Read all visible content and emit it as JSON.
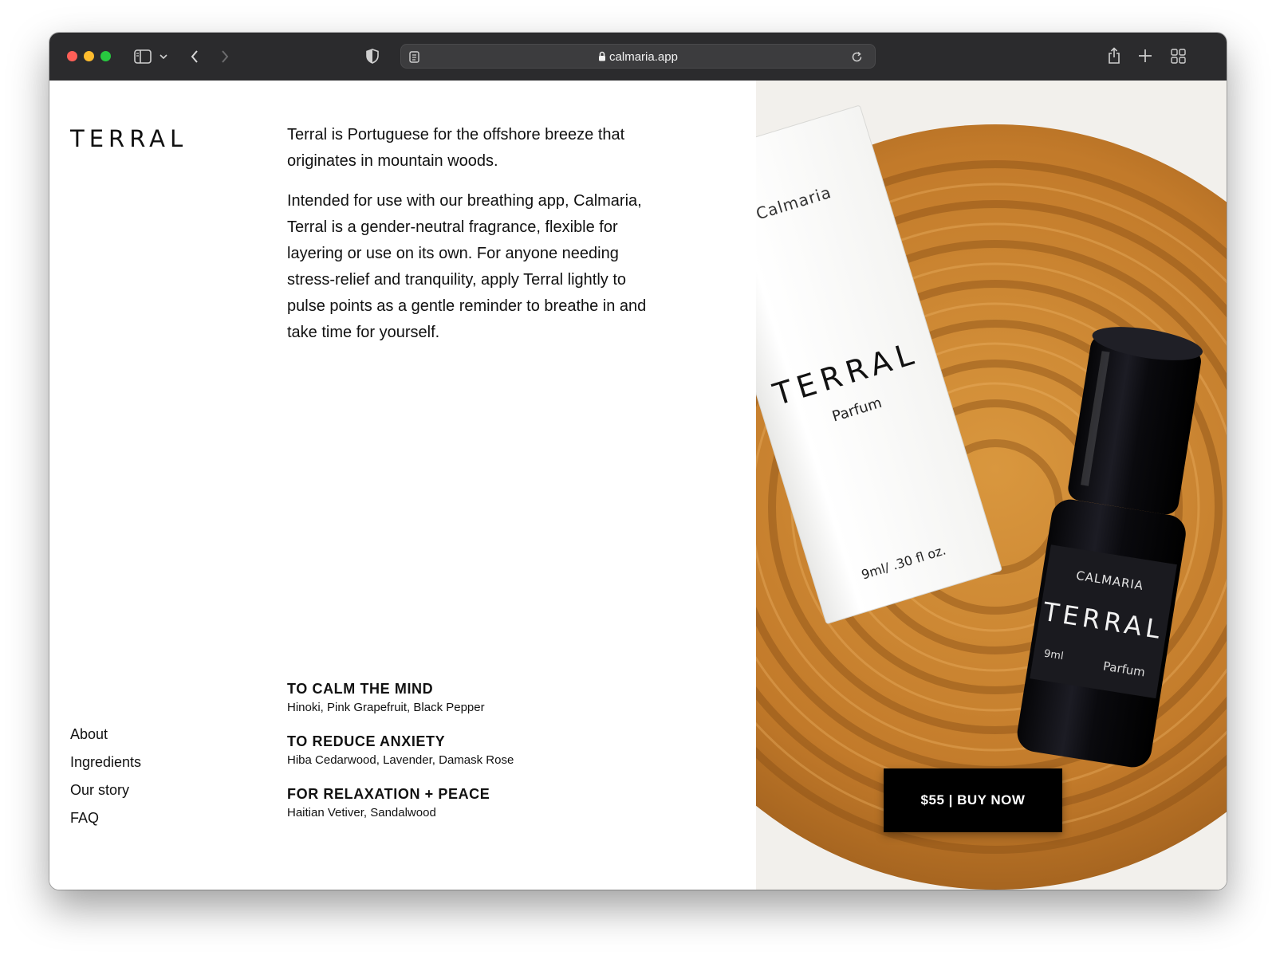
{
  "browser": {
    "url": "calmaria.app"
  },
  "page": {
    "brand": "TERRAL",
    "intro": [
      "Terral is Portuguese for the offshore breeze that originates in mountain woods.",
      "Intended for use with our breathing app, Calmaria, Terral is a gender-neutral fragrance, flexible for layering or use on its own. For anyone needing stress-relief and tranquility, apply Terral lightly to pulse points as a gentle reminder to breathe in and take time for yourself."
    ],
    "nav": [
      "About",
      "Ingredients",
      "Our story",
      "FAQ"
    ],
    "benefits": [
      {
        "title": "TO CALM THE MIND",
        "notes": "Hinoki, Pink Grapefruit, Black Pepper"
      },
      {
        "title": "TO REDUCE ANXIETY",
        "notes": "Hiba Cedarwood, Lavender, Damask Rose"
      },
      {
        "title": "FOR RELAXATION + PEACE",
        "notes": "Haitian Vetiver, Sandalwood"
      }
    ],
    "buy_label": "$55 | BUY NOW"
  },
  "product_photo": {
    "box": {
      "brand": "Calmaria",
      "name": "TERRAL",
      "type": "Parfum",
      "volume": "9ml/ .30 fl oz."
    },
    "bottle": {
      "brand": "CALMARIA",
      "name": "TERRAL",
      "volume": "9ml",
      "type": "Parfum"
    }
  },
  "colors": {
    "toolbar": "#2b2b2d",
    "button": "#000000",
    "wood": "#c9832e"
  }
}
